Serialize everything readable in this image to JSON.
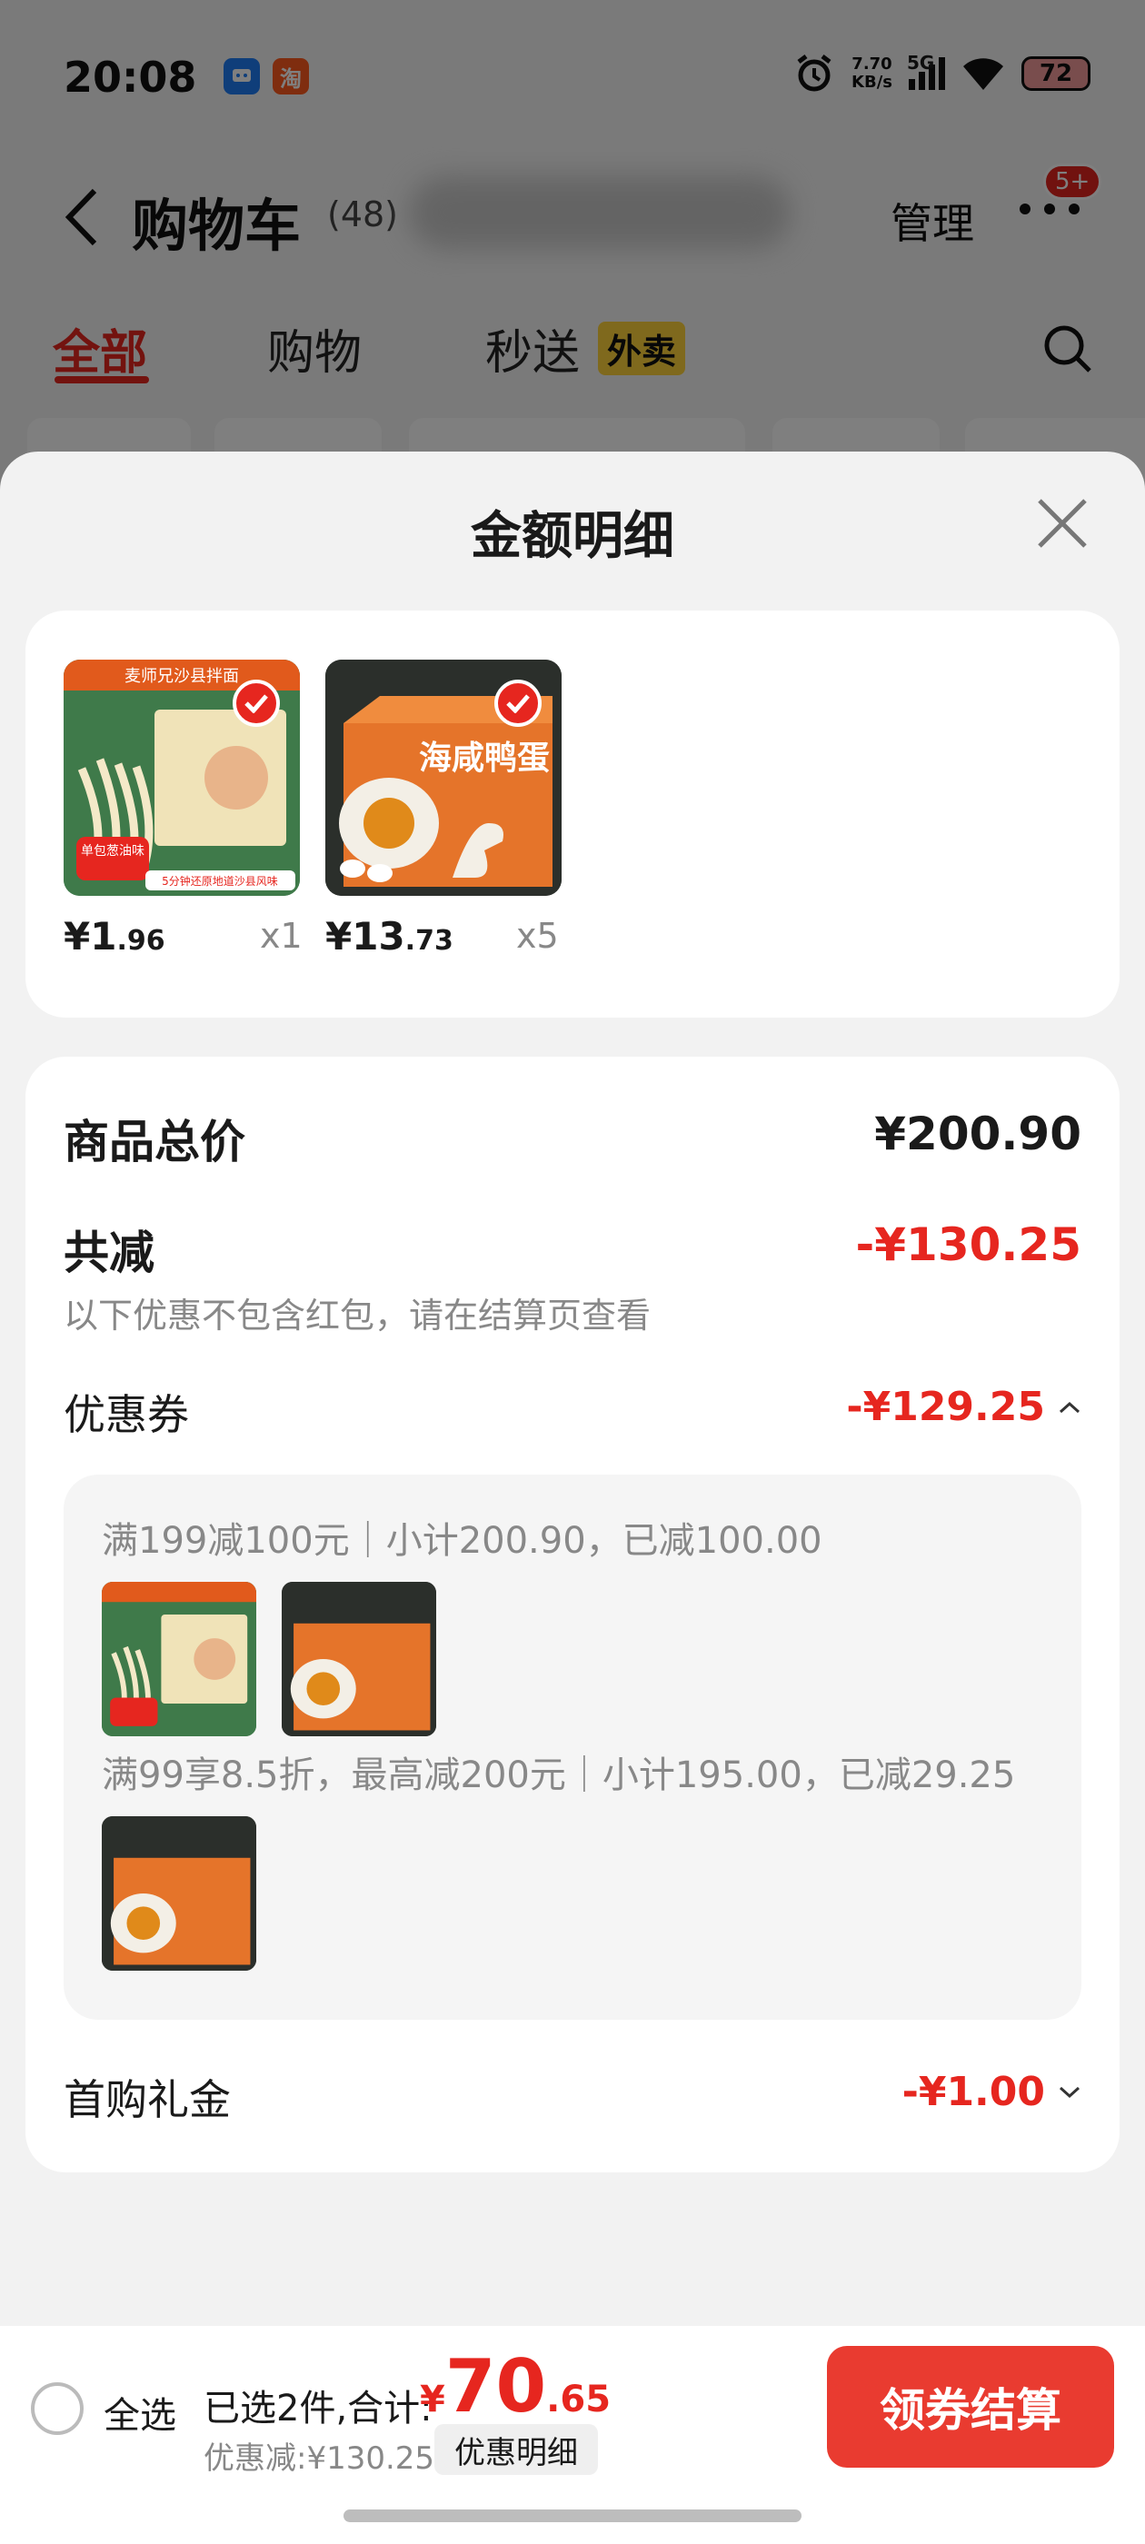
{
  "status": {
    "time": "20:08",
    "net_speed_value": "7.70",
    "net_speed_unit": "KB/s",
    "signal_label": "5G",
    "battery": "72",
    "app1_icon": "blue-message-app-icon",
    "app2_label": "淘"
  },
  "cart": {
    "back_icon": "chevron-left-icon",
    "title": "购物车",
    "count": "(48)",
    "manage": "管理",
    "more_badge": "5+",
    "tabs": [
      {
        "label": "全部",
        "active": true
      },
      {
        "label": "购物",
        "active": false
      },
      {
        "label": "秒送",
        "active": false
      }
    ],
    "waimai_badge": "外卖"
  },
  "sheet": {
    "title": "金额明细",
    "products": [
      {
        "price_int": "¥1",
        "price_dec": ".96",
        "qty": "x1",
        "image": "noodle-pack-image",
        "selected": true
      },
      {
        "price_int": "¥13",
        "price_dec": ".73",
        "qty": "x5",
        "image": "salted-duck-egg-box-image",
        "selected": true
      }
    ],
    "product_images": {
      "noodle_banner": "麦师兄沙县拌面",
      "noodle_tag": "单包葱油味",
      "noodle_caption": "5分钟还原地道沙县风味",
      "egg_box_text": "海咸鸭蛋"
    },
    "summary": {
      "total_label": "商品总价",
      "total_value": "¥200.90",
      "reduced_label": "共减",
      "reduced_value": "-¥130.25",
      "note": "以下优惠不包含红包，请在结算页查看",
      "coupon_label": "优惠券",
      "coupon_value": "-¥129.25",
      "coupon_lines": [
        "满199减100元｜小计200.90，已减100.00",
        "满99享8.5折，最高减200元｜小计195.00，已减29.25"
      ],
      "gift_label": "首购礼金",
      "gift_value": "-¥1.00"
    }
  },
  "bottom": {
    "select_all": "全选",
    "summary": "已选2件,合计:",
    "total_sym": "¥",
    "total_int": "70",
    "total_dec": ".65",
    "discount": "优惠减:¥130.25",
    "detail_button": "优惠明细",
    "checkout_button": "领券结算"
  },
  "colors": {
    "accent": "#e6261f",
    "checkout": "#e93b30",
    "waimai": "#ffd23a"
  }
}
